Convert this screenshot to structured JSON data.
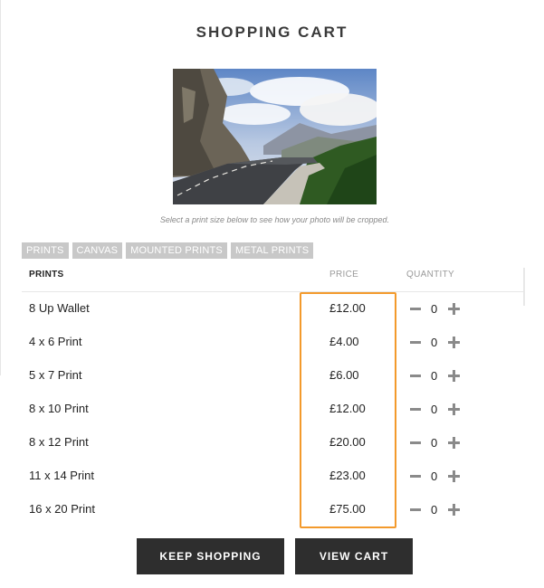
{
  "page": {
    "title": "SHOPPING CART"
  },
  "photo": {
    "alt": "Mountain road"
  },
  "caption": "Select a print size below to see how your photo will be cropped.",
  "tabs": [
    {
      "label": "PRINTS"
    },
    {
      "label": "CANVAS"
    },
    {
      "label": "MOUNTED PRINTS"
    },
    {
      "label": "METAL PRINTS"
    }
  ],
  "table": {
    "headers": {
      "name": "PRINTS",
      "price": "PRICE",
      "quantity": "QUANTITY"
    },
    "rows": [
      {
        "name": "8 Up Wallet",
        "price": "£12.00",
        "qty": "0"
      },
      {
        "name": "4 x 6 Print",
        "price": "£4.00",
        "qty": "0"
      },
      {
        "name": "5 x 7 Print",
        "price": "£6.00",
        "qty": "0"
      },
      {
        "name": "8 x 10 Print",
        "price": "£12.00",
        "qty": "0"
      },
      {
        "name": "8 x 12 Print",
        "price": "£20.00",
        "qty": "0"
      },
      {
        "name": "11 x 14 Print",
        "price": "£23.00",
        "qty": "0"
      },
      {
        "name": "16 x 20 Print",
        "price": "£75.00",
        "qty": "0"
      }
    ]
  },
  "buttons": {
    "keep_shopping": "KEEP SHOPPING",
    "view_cart": "VIEW CART"
  },
  "colors": {
    "highlight": "#f39a2c",
    "button_bg": "#2e2e2e",
    "tab_bg": "#c8c8c8"
  },
  "icons": {
    "decrement": "minus-icon",
    "increment": "plus-icon"
  }
}
